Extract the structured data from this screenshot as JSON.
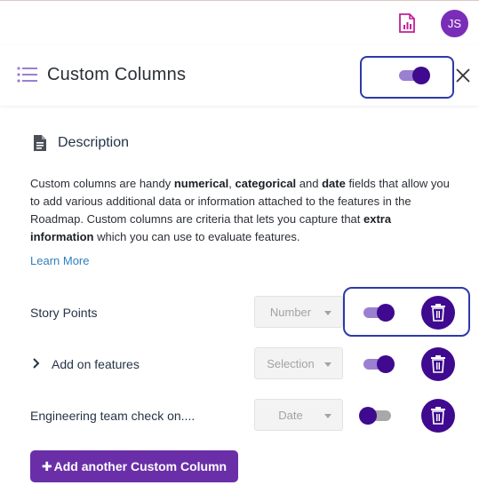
{
  "topbar": {
    "avatar_initials": "JS",
    "report_icon": "report-document-icon"
  },
  "panel": {
    "title": "Custom Columns",
    "header_toggle_on": true
  },
  "description": {
    "title": "Description",
    "p1": "Custom columns are handy ",
    "b1": "numerical",
    "p2": ", ",
    "b2": "categorical",
    "p3": " and ",
    "b3": "date",
    "p4": " fields that allow you to add various additional data or information attached to the features in the Roadmap. Custom columns are criteria that lets you capture that ",
    "b4": "extra information",
    "p5": " which you can use to evaluate features.",
    "learn_more": "Learn More"
  },
  "columns": [
    {
      "label": "Story Points",
      "type": "Number",
      "enabled": true
    },
    {
      "label": "Add on features",
      "type": "Selection",
      "enabled": true
    },
    {
      "label": "Engineering team check on....",
      "type": "Date",
      "enabled": false
    }
  ],
  "add_button": {
    "label": "Add another Custom Column"
  },
  "colors": {
    "accent_dark": "#3f0a8f",
    "accent_track": "#9b7fd1",
    "off_track": "#a8a8a8",
    "button": "#6a2fa8",
    "highlight": "#2e3aa8",
    "link": "#2f7fbf"
  }
}
